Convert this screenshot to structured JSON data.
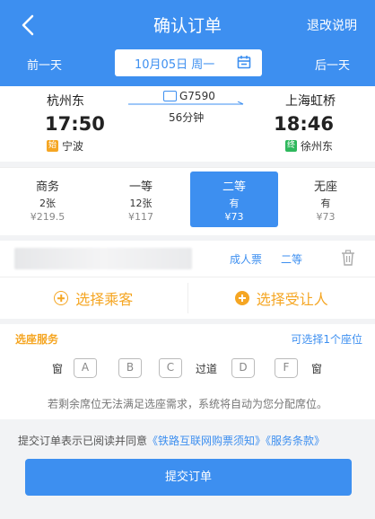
{
  "header": {
    "title": "确认订单",
    "refund_label": "退改说明",
    "prev_day": "前一天",
    "next_day": "后一天",
    "date": "10月05日 周一"
  },
  "train": {
    "from_station": "杭州东",
    "to_station": "上海虹桥",
    "code": "G7590",
    "duration": "56分钟",
    "depart_time": "17:50",
    "arrive_time": "18:46",
    "from_tag": "始",
    "from_sub": "宁波",
    "to_tag": "终",
    "to_sub": "徐州东"
  },
  "seats": [
    {
      "name": "商务",
      "count": "2张",
      "price": "¥219.5"
    },
    {
      "name": "一等",
      "count": "12张",
      "price": "¥117"
    },
    {
      "name": "二等",
      "count": "有",
      "price": "¥73"
    },
    {
      "name": "无座",
      "count": "有",
      "price": "¥73"
    }
  ],
  "passenger": {
    "ticket_type": "成人票",
    "seat_class": "二等"
  },
  "choose": {
    "passenger_label": "选择乘客",
    "transferee_label": "选择受让人"
  },
  "seat_service": {
    "label": "选座服务",
    "available": "可选择1个座位",
    "window_left": "窗",
    "aisle": "过道",
    "window_right": "窗",
    "seat_a": "A",
    "seat_b": "B",
    "seat_c": "C",
    "seat_d": "D",
    "seat_f": "F",
    "note": "若剩余席位无法满足选座需求，系统将自动为您分配席位。"
  },
  "agreement": {
    "prefix": "提交订单表示已阅读并同意",
    "link1": "《铁路互联网购票须知》",
    "link2": "《服务条款》"
  },
  "submit_label": "提交订单",
  "colors": {
    "primary": "#3d8ff0",
    "accent": "#f5a623",
    "start_tag": "#f5a623",
    "end_tag": "#2eb85c"
  }
}
